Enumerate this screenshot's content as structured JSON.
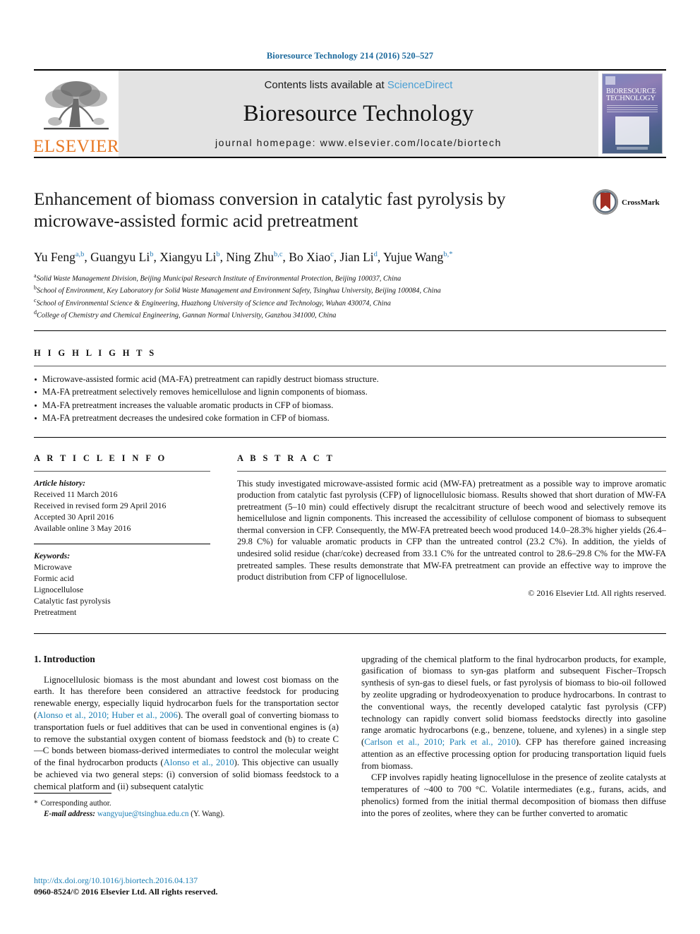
{
  "running_head": "Bioresource Technology 214 (2016) 520–527",
  "masthead": {
    "publisher_name": "ELSEVIER",
    "contents_prefix": "Contents lists available at ",
    "contents_link": "ScienceDirect",
    "journal_title": "Bioresource Technology",
    "homepage": "journal homepage: www.elsevier.com/locate/biortech",
    "cover_title_line1": "BIORESOURCE",
    "cover_title_line2": "TECHNOLOGY"
  },
  "article": {
    "title": "Enhancement of biomass conversion in catalytic fast pyrolysis by microwave-assisted formic acid pretreatment",
    "crossmark_label": "CrossMark",
    "authors": [
      {
        "name": "Yu Feng",
        "sup": "a,b",
        "sep": ", "
      },
      {
        "name": "Guangyu Li",
        "sup": "b",
        "sep": ", "
      },
      {
        "name": "Xiangyu Li",
        "sup": "b",
        "sep": ", "
      },
      {
        "name": "Ning Zhu",
        "sup": "b,c",
        "sep": ", "
      },
      {
        "name": "Bo Xiao",
        "sup": "c",
        "sep": ", "
      },
      {
        "name": "Jian Li",
        "sup": "d",
        "sep": ", "
      },
      {
        "name": "Yujue Wang",
        "sup": "b,*",
        "sep": ""
      }
    ],
    "affiliations": [
      {
        "mark": "a",
        "text": "Solid Waste Management Division, Beijing Municipal Research Institute of Environmental Protection, Beijing 100037, China"
      },
      {
        "mark": "b",
        "text": "School of Environment, Key Laboratory for Solid Waste Management and Environment Safety, Tsinghua University, Beijing 100084, China"
      },
      {
        "mark": "c",
        "text": "School of Environmental Science & Engineering, Huazhong University of Science and Technology, Wuhan 430074, China"
      },
      {
        "mark": "d",
        "text": "College of Chemistry and Chemical Engineering, Gannan Normal University, Ganzhou 341000, China"
      }
    ]
  },
  "highlights": {
    "heading": "H I G H L I G H T S",
    "items": [
      "Microwave-assisted formic acid (MA-FA) pretreatment can rapidly destruct biomass structure.",
      "MA-FA pretreatment selectively removes hemicellulose and lignin components of biomass.",
      "MA-FA pretreatment increases the valuable aromatic products in CFP of biomass.",
      "MA-FA pretreatment decreases the undesired coke formation in CFP of biomass."
    ]
  },
  "article_info": {
    "heading": "A R T I C L E   I N F O",
    "history_label": "Article history:",
    "history": [
      "Received 11 March 2016",
      "Received in revised form 29 April 2016",
      "Accepted 30 April 2016",
      "Available online 3 May 2016"
    ],
    "keywords_label": "Keywords:",
    "keywords": [
      "Microwave",
      "Formic acid",
      "Lignocellulose",
      "Catalytic fast pyrolysis",
      "Pretreatment"
    ]
  },
  "abstract": {
    "heading": "A B S T R A C T",
    "text": "This study investigated microwave-assisted formic acid (MW-FA) pretreatment as a possible way to improve aromatic production from catalytic fast pyrolysis (CFP) of lignocellulosic biomass. Results showed that short duration of MW-FA pretreatment (5–10 min) could effectively disrupt the recalcitrant structure of beech wood and selectively remove its hemicellulose and lignin components. This increased the accessibility of cellulose component of biomass to subsequent thermal conversion in CFP. Consequently, the MW-FA pretreated beech wood produced 14.0–28.3% higher yields (26.4–29.8 C%) for valuable aromatic products in CFP than the untreated control (23.2 C%). In addition, the yields of undesired solid residue (char/coke) decreased from 33.1 C% for the untreated control to 28.6–29.8 C% for the MW-FA pretreated samples. These results demonstrate that MW-FA pretreatment can provide an effective way to improve the product distribution from CFP of lignocellulose.",
    "copyright": "© 2016 Elsevier Ltd. All rights reserved."
  },
  "introduction": {
    "heading": "1. Introduction",
    "left_para_1_a": "Lignocellulosic biomass is the most abundant and lowest cost biomass on the earth. It has therefore been considered an attractive feedstock for producing renewable energy, especially liquid hydrocarbon fuels for the transportation sector (",
    "left_ref_1": "Alonso et al., 2010; Huber et al., 2006",
    "left_para_1_b": "). The overall goal of converting biomass to transportation fuels or fuel additives that can be used in conventional engines is (a) to remove the substantial oxygen content of biomass feedstock and (b) to create C—C bonds between biomass-derived intermediates to control the molecular weight of the final hydrocarbon products (",
    "left_ref_2": "Alonso et al., 2010",
    "left_para_1_c": "). This objective can usually be achieved via two general steps: (i) conversion of solid biomass feedstock to a chemical platform and (ii) subsequent catalytic",
    "right_para_1_a": "upgrading of the chemical platform to the final hydrocarbon products, for example, gasification of biomass to syn-gas platform and subsequent Fischer–Tropsch synthesis of syn-gas to diesel fuels, or fast pyrolysis of biomass to bio-oil followed by zeolite upgrading or hydrodeoxyenation to produce hydrocarbons. In contrast to the conventional ways, the recently developed catalytic fast pyrolysis (CFP) technology can rapidly convert solid biomass feedstocks directly into gasoline range aromatic hydrocarbons (e.g., benzene, toluene, and xylenes) in a single step (",
    "right_ref_1": "Carlson et al., 2010; Park et al., 2010",
    "right_para_1_b": "). CFP has therefore gained increasing attention as an effective processing option for producing transportation liquid fuels from biomass.",
    "right_para_2": "CFP involves rapidly heating lignocellulose in the presence of zeolite catalysts at temperatures of ~400 to 700 °C. Volatile intermediates (e.g., furans, acids, and phenolics) formed from the initial thermal decomposition of biomass then diffuse into the pores of zeolites, where they can be further converted to aromatic"
  },
  "footnote": {
    "star": "*",
    "corresponding": "Corresponding author.",
    "email_label": "E-mail address:",
    "email": "wangyujue@tsinghua.edu.cn",
    "email_suffix": "(Y. Wang)."
  },
  "page_footer": {
    "doi": "http://dx.doi.org/10.1016/j.biortech.2016.04.137",
    "issn": "0960-8524/© 2016 Elsevier Ltd. All rights reserved."
  },
  "colors": {
    "link": "#1b7fb5",
    "running_head": "#1d6a9c",
    "elsevier_orange": "#E87722",
    "masthead_bg": "#e3e3e3"
  }
}
